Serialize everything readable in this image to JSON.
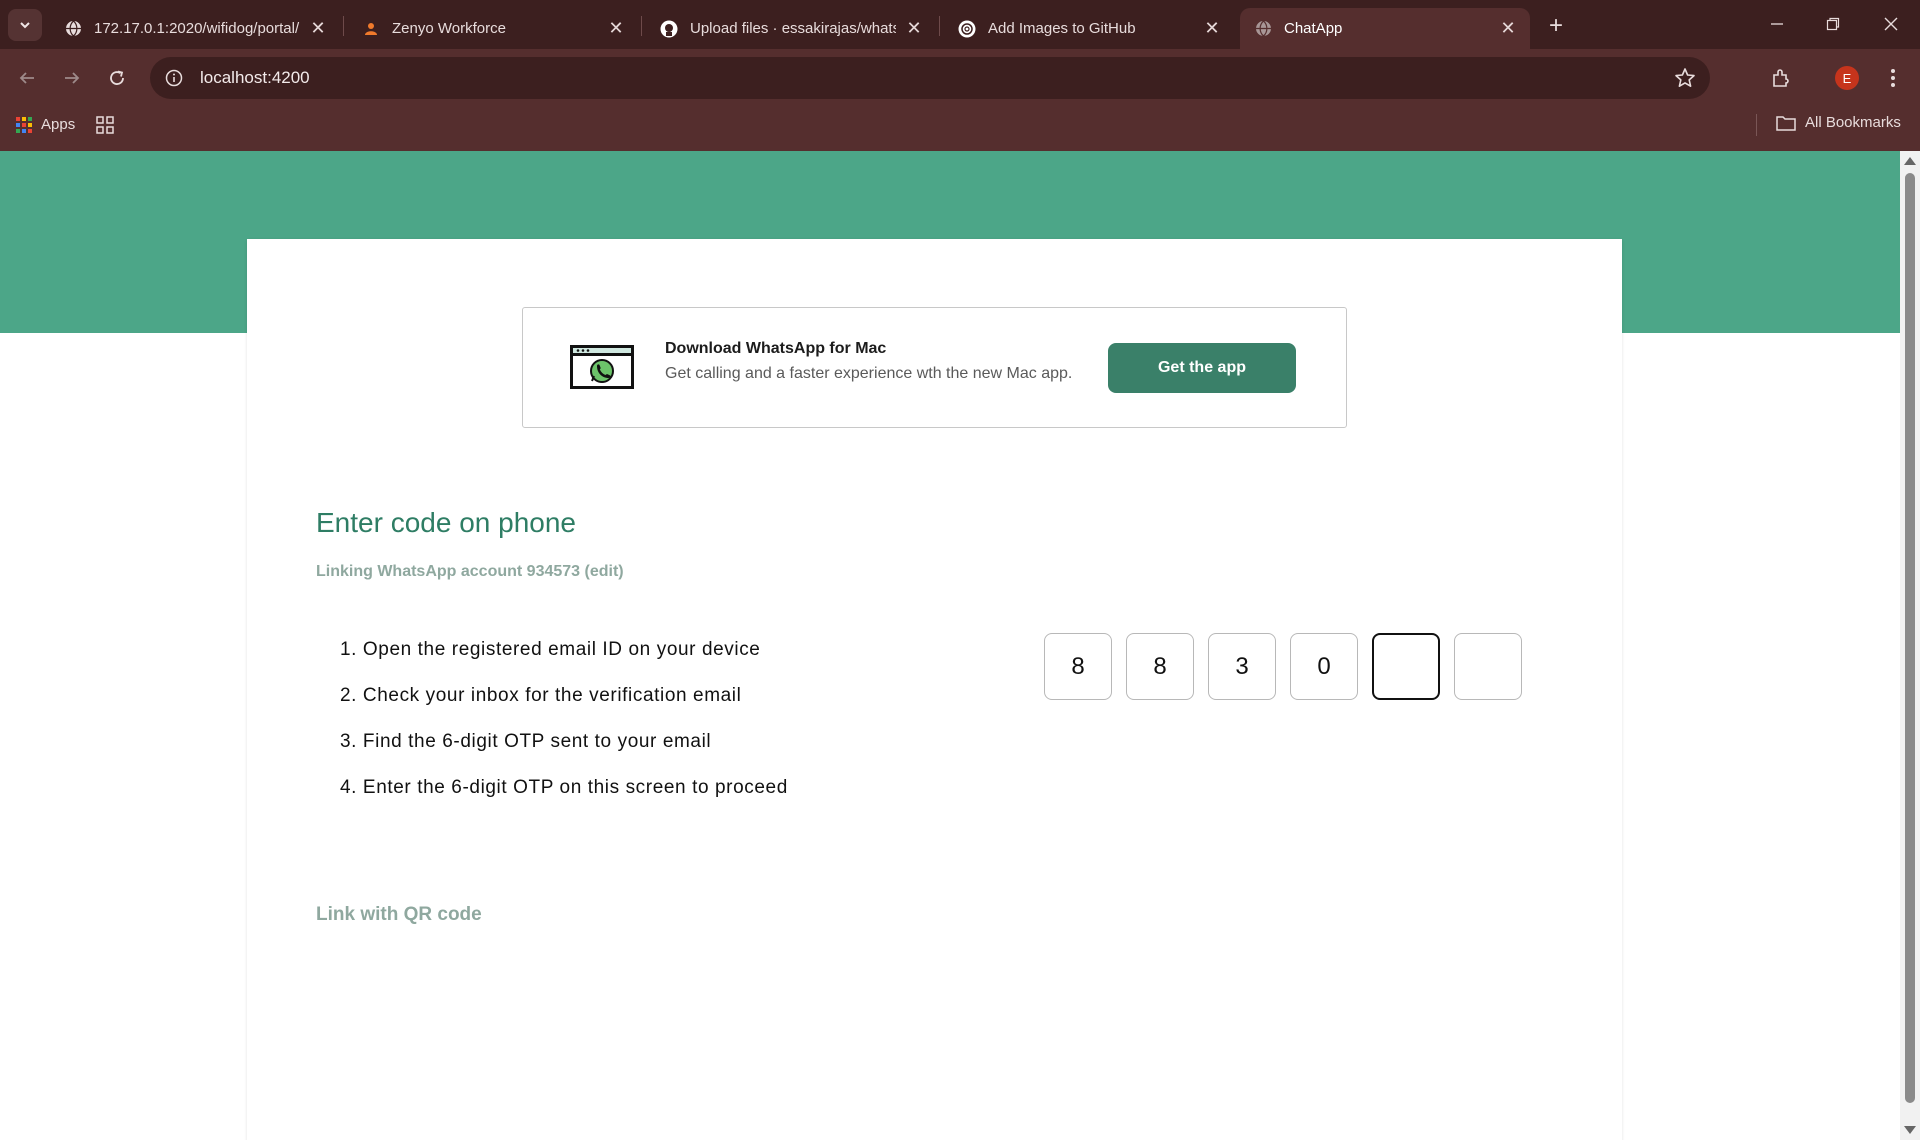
{
  "browser": {
    "tabs": [
      {
        "title": "172.17.0.1:2020/wifidog/portal/",
        "icon": "globe-icon"
      },
      {
        "title": "Zenyo Workforce",
        "icon": "person-icon"
      },
      {
        "title": "Upload files · essakirajas/whatsa",
        "icon": "github-icon"
      },
      {
        "title": "Add Images to GitHub",
        "icon": "openai-icon"
      },
      {
        "title": "ChatApp",
        "icon": "globe-icon",
        "active": true
      }
    ],
    "url": "localhost:4200",
    "profile_initial": "E",
    "bookmarks": {
      "apps_label": "Apps",
      "all_bookmarks_label": "All Bookmarks"
    }
  },
  "banner": {
    "title": "Download WhatsApp for Mac",
    "subtitle": "Get calling and a faster experience wth the new Mac app.",
    "button_label": "Get the app"
  },
  "main": {
    "heading": "Enter code on phone",
    "linking_prefix": "Linking WhatsApp account 934573",
    "edit_label": "(edit)",
    "steps": [
      "1. Open the registered email ID on your device",
      "2. Check your inbox for the verification email",
      "3. Find the 6-digit OTP sent to your email",
      "4. Enter the 6-digit OTP on this screen to proceed"
    ],
    "otp": [
      "8",
      "8",
      "3",
      "0",
      "",
      ""
    ],
    "qr_link_label": "Link with QR code"
  },
  "colors": {
    "header_band": "#4ca688",
    "accent": "#2e7d64",
    "button": "#3a8069",
    "muted": "#8fa89f",
    "chrome_dark": "#3c1f1f",
    "chrome": "#552e2e"
  }
}
